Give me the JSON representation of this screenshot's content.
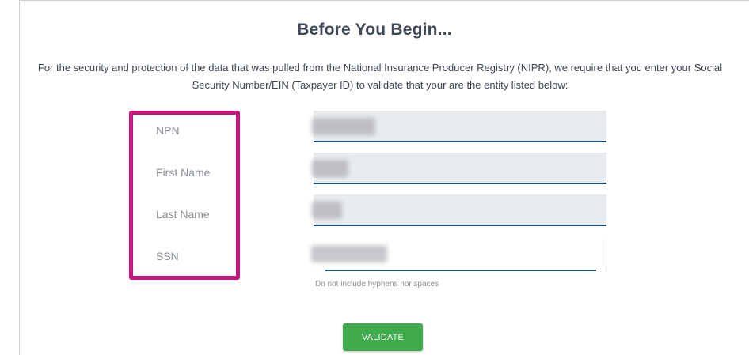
{
  "header": {
    "title": "Before You Begin..."
  },
  "intro": {
    "text": "For the security and protection of the data that was pulled from the National Insurance Producer Registry (NIPR), we require that you enter your Social Security Number/EIN (Taxpayer ID) to validate that your are the entity listed below:"
  },
  "form": {
    "fields": [
      {
        "label": "NPN",
        "value": ""
      },
      {
        "label": "First Name",
        "value": ""
      },
      {
        "label": "Last Name",
        "value": ""
      },
      {
        "label": "SSN",
        "value": ""
      }
    ],
    "ssn_hint": "Do not include hyphens nor spaces",
    "validate_label": "VALIDATE"
  },
  "colors": {
    "highlight_border": "#c8167e",
    "button": "#3fab4c",
    "field_underline": "#1f4e79",
    "field_background": "#e9ecef"
  }
}
